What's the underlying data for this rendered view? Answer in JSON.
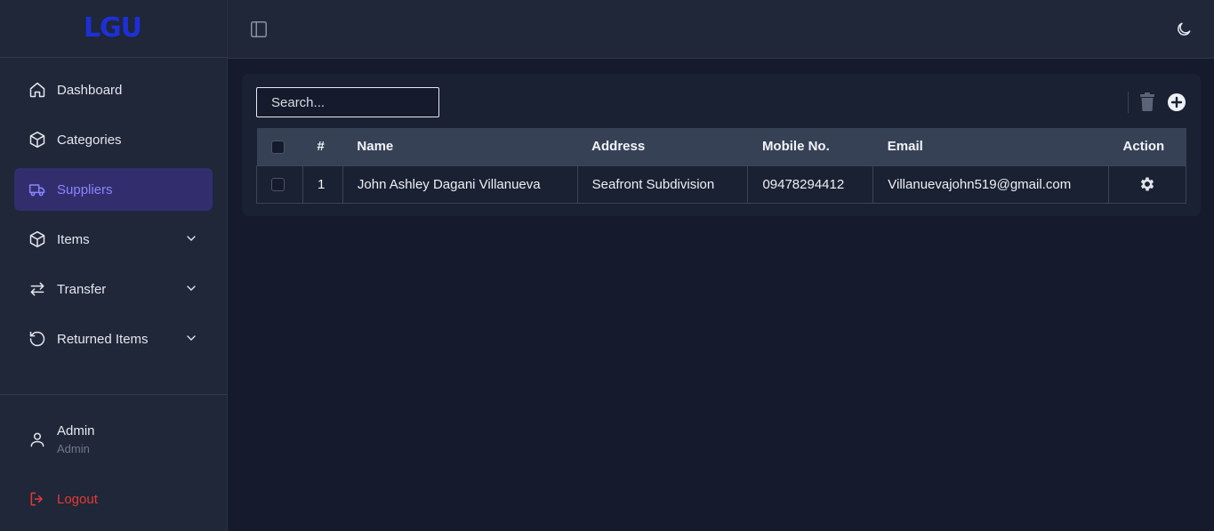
{
  "brand": {
    "logo_text": "LGU",
    "logo_color": "#1e2fd6"
  },
  "sidebar": {
    "items": [
      {
        "label": "Dashboard",
        "icon": "home-icon"
      },
      {
        "label": "Categories",
        "icon": "cube-icon"
      },
      {
        "label": "Suppliers",
        "icon": "truck-icon",
        "active": true
      },
      {
        "label": "Items",
        "icon": "cube-icon",
        "expandable": true
      },
      {
        "label": "Transfer",
        "icon": "arrows-left-right-icon",
        "expandable": true
      },
      {
        "label": "Returned Items",
        "icon": "rotate-ccw-icon",
        "expandable": true
      }
    ],
    "user": {
      "name": "Admin",
      "role": "Admin",
      "icon": "user-icon"
    },
    "logout": {
      "label": "Logout",
      "icon": "logout-icon",
      "color": "#e53935"
    }
  },
  "header": {
    "toggle_icon": "sidebar-toggle-icon",
    "theme_icon": "moon-icon"
  },
  "toolbar": {
    "search_placeholder": "Search...",
    "delete_icon": "trash-icon",
    "add_icon": "plus-circle-icon"
  },
  "table": {
    "columns": [
      "#",
      "Name",
      "Address",
      "Mobile No.",
      "Email",
      "Action"
    ],
    "rows": [
      {
        "index": "1",
        "name": "John Ashley Dagani Villanueva",
        "address": "Seafront Subdivision",
        "mobile": "09478294412",
        "email": "Villanuevajohn519@gmail.com",
        "action_icon": "gear-icon"
      }
    ]
  },
  "colors": {
    "active_nav_bg": "#322e6e",
    "active_nav_text": "#8b84ff",
    "sidebar_bg": "#1f2738",
    "page_bg": "#151b2c"
  }
}
